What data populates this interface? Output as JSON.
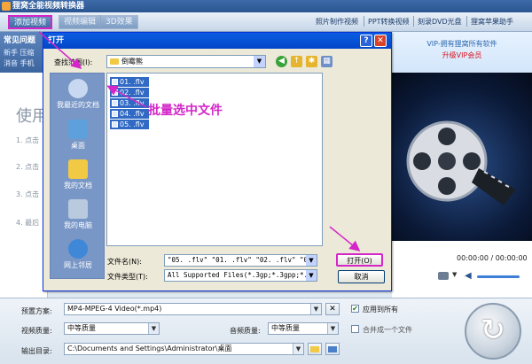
{
  "app": {
    "title": "狸窝全能视频转换器"
  },
  "toolbar": {
    "add_video": "添加视频",
    "btn2": "视频编辑",
    "btn3": "3D效果",
    "links": [
      "照片制作视频",
      "PPT转换视频",
      "刻录DVD光盘",
      "狸窝苹果助手"
    ]
  },
  "left": {
    "faq_title": "常见问题",
    "faq_row1": "新手  压缩",
    "faq_row2": "消音  手机",
    "usage_title": "使用",
    "steps": [
      "1. 点击",
      "2. 点击",
      "3. 点击",
      "4. 最后"
    ]
  },
  "right": {
    "vip_line1": "VIP-拥有狸窝所有软件",
    "vip_line2": "升级VIP会员",
    "time": "00:00:00 / 00:00:00"
  },
  "dialog": {
    "title": "打开",
    "look_in_label": "查找范围(I):",
    "look_in_value": "倒霉熊",
    "places": [
      "我最近的文档",
      "桌面",
      "我的文档",
      "我的电脑",
      "网上邻居"
    ],
    "files": [
      "01. .flv",
      "02. .flv",
      "03. .flv",
      "04. .flv",
      "05. .flv"
    ],
    "filename_label": "文件名(N):",
    "filename_value": "\"05. .flv\" \"01. .flv\" \"02. .flv\" \"03. .flv",
    "filetype_label": "文件类型(T):",
    "filetype_value": "All Supported Files(*.3gp;*.3gpp;*.3g",
    "open_btn": "打开(O)",
    "cancel_btn": "取消"
  },
  "annotation": "批量选中文件",
  "settings": {
    "preset_label": "预置方案:",
    "preset_value": "MP4-MPEG-4 Video(*.mp4)",
    "apply_all": "应用到所有",
    "video_q_label": "视频质量:",
    "video_q_value": "中等质量",
    "audio_q_label": "音频质量:",
    "audio_q_value": "中等质量",
    "merge": "合并成一个文件",
    "output_label": "输出目录:",
    "output_value": "C:\\Documents and Settings\\Administrator\\桌面"
  },
  "colors": {
    "annotation": "#d426c8",
    "xp_blue": "#0a5ee2",
    "selection": "#316ac5"
  }
}
